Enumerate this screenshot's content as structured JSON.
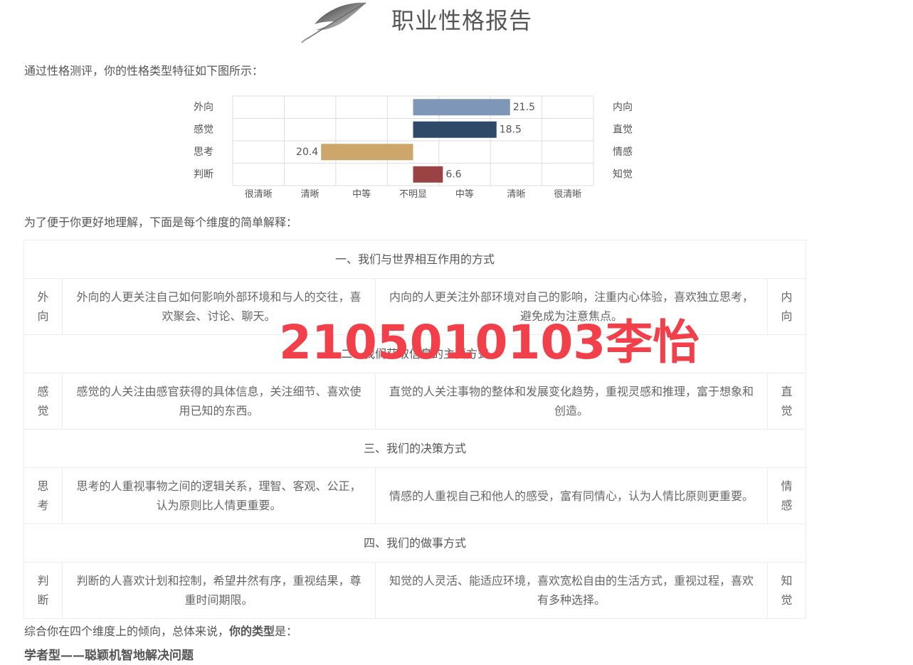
{
  "header": {
    "title": "职业性格报告"
  },
  "intro_text": "通过性格测评，你的性格类型特征如下图所示：",
  "chart_data": {
    "type": "bar",
    "orientation": "horizontal-diverging",
    "left_labels": [
      "外向",
      "感觉",
      "思考",
      "判断"
    ],
    "right_labels": [
      "内向",
      "直觉",
      "情感",
      "知觉"
    ],
    "values": [
      21.5,
      18.5,
      -20.4,
      6.6
    ],
    "value_labels": [
      "21.5",
      "18.5",
      "20.4",
      "6.6"
    ],
    "colors": [
      "#7e97b8",
      "#2f4a68",
      "#cda66b",
      "#9b4244"
    ],
    "x_ticks": [
      "很清晰",
      "清晰",
      "中等",
      "不明显",
      "中等",
      "清晰",
      "很清晰"
    ],
    "xlim": [
      -40,
      40
    ],
    "grid": true
  },
  "explain_text": "为了便于你更好地理解，下面是每个维度的简单解释：",
  "dimensions": [
    {
      "section": "一、我们与世界相互作用的方式",
      "left_label": "外向",
      "left_desc": "外向的人更关注自己如何影响外部环境和与人的交往，喜欢聚会、讨论、聊天。",
      "right_desc": "内向的人更关注外部环境对自己的影响，注重内心体验，喜欢独立思考，避免成为注意焦点。",
      "right_label": "内向"
    },
    {
      "section": "二、我们获取信息的主要方式",
      "left_label": "感觉",
      "left_desc": "感觉的人关注由感官获得的具体信息，关注细节、喜欢使用已知的东西。",
      "right_desc": "直觉的人关注事物的整体和发展变化趋势，重视灵感和推理，富于想象和创造。",
      "right_label": "直觉"
    },
    {
      "section": "三、我们的决策方式",
      "left_label": "思考",
      "left_desc": "思考的人重视事物之间的逻辑关系，理智、客观、公正，认为原则比人情更重要。",
      "right_desc": "情感的人重视自己和他人的感受，富有同情心，认为人情比原则更重要。",
      "right_label": "情感"
    },
    {
      "section": "四、我们的做事方式",
      "left_label": "判断",
      "left_desc": "判断的人喜欢计划和控制，希望井然有序，重视结果，尊重时间期限。",
      "right_desc": "知觉的人灵活、能适应环境，喜欢宽松自由的生活方式，重视过程，喜欢有多种选择。",
      "right_label": "知觉"
    }
  ],
  "summary": {
    "prefix": "综合你在四个维度上的倾向，总体来说，",
    "bold": "你的类型",
    "suffix": "是："
  },
  "result_text": "学者型——聪颖机智地解决问题",
  "watermark": "2105010103李怡"
}
